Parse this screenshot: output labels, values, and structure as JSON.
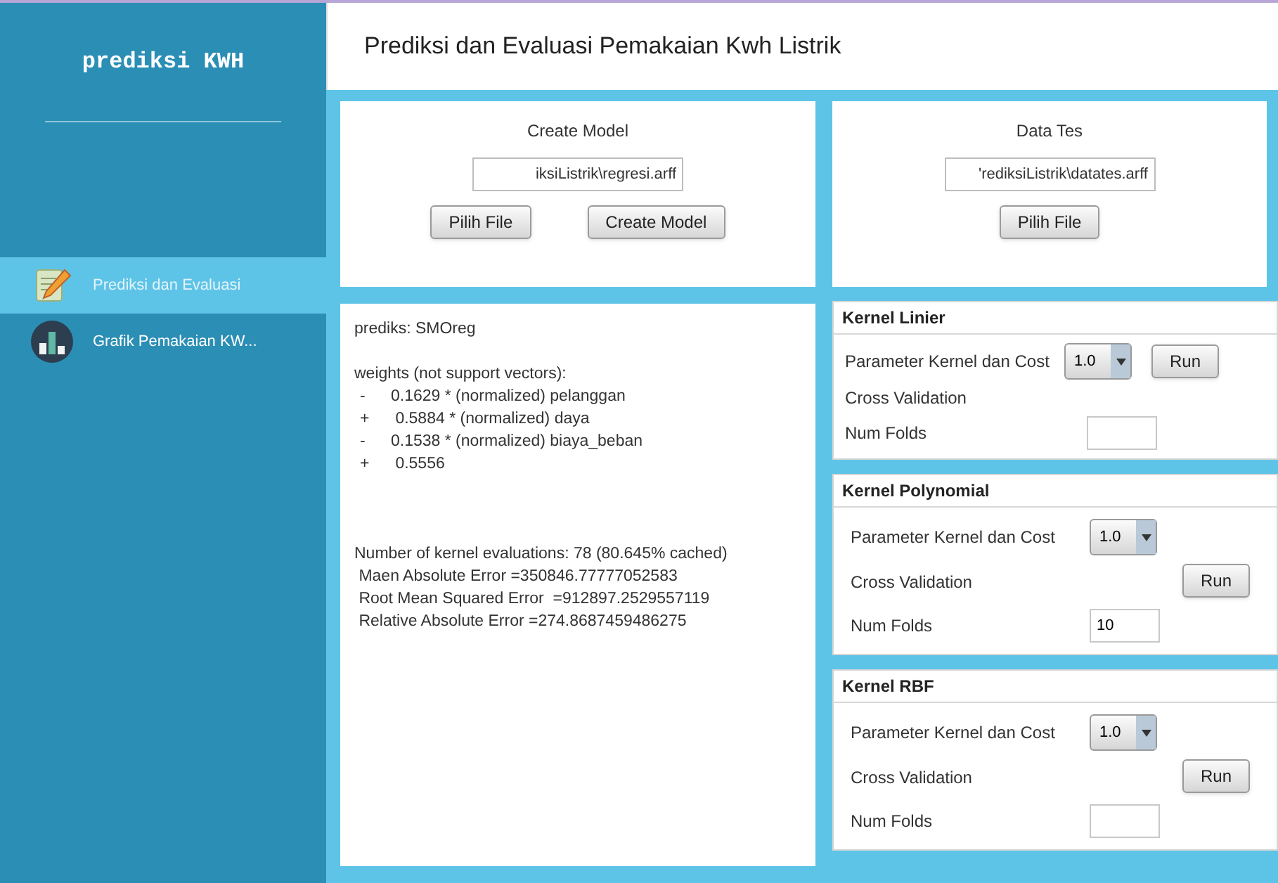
{
  "sidebar": {
    "title": "prediksi KWH",
    "items": [
      {
        "label": "Prediksi dan Evaluasi",
        "kind": "edit",
        "selected": true
      },
      {
        "label": "Grafik Pemakaian KW...",
        "kind": "chart",
        "selected": false
      }
    ]
  },
  "header": {
    "title": "Prediksi dan Evaluasi Pemakaian Kwh Listrik"
  },
  "create_model": {
    "title": "Create Model",
    "file_value": "iksiListrik\\regresi.arff",
    "buttons": [
      "Pilih File",
      "Create Model"
    ]
  },
  "data_tes": {
    "title": "Data Tes",
    "file_value": "'rediksiListrik\\datates.arff",
    "buttons": [
      "Pilih File"
    ]
  },
  "output": {
    "lines": [
      {
        "kind": "text",
        "text": "prediks: SMOreg"
      },
      {
        "kind": "gap"
      },
      {
        "kind": "text",
        "text": "weights (not support vectors):"
      },
      {
        "kind": "term",
        "sign": "-",
        "text": "0.1629 * (normalized) pelanggan"
      },
      {
        "kind": "term",
        "sign": "+",
        "text": " 0.5884 * (normalized) daya"
      },
      {
        "kind": "term",
        "sign": "-",
        "text": "0.1538 * (normalized) biaya_beban"
      },
      {
        "kind": "term",
        "sign": "+",
        "text": " 0.5556"
      },
      {
        "kind": "gap"
      },
      {
        "kind": "gap"
      },
      {
        "kind": "gap"
      },
      {
        "kind": "text",
        "text": "Number of kernel evaluations: 78 (80.645% cached)"
      },
      {
        "kind": "text",
        "text": " Maen Absolute Error =350846.77777052583"
      },
      {
        "kind": "text",
        "text": " Root Mean Squared Error  =912897.2529557119"
      },
      {
        "kind": "text",
        "text": " Relative Absolute Error =274.8687459486275"
      }
    ]
  },
  "kernels": [
    {
      "title": "Kernel Linier",
      "kind": "inline",
      "param_label": "Parameter Kernel dan Cost",
      "param_value": "1.0",
      "run": "Run",
      "cv_label": "Cross Validation",
      "folds_label": "Num Folds"
    },
    {
      "title": "Kernel Polynomial",
      "kind": "stacked",
      "param_label": "Parameter Kernel dan Cost",
      "param_value": "1.0",
      "run": "Run",
      "cv_label": "Cross Validation",
      "folds_label": "Num Folds",
      "folds_value": "10"
    },
    {
      "title": "Kernel RBF",
      "kind": "stacked",
      "param_label": "Parameter Kernel dan Cost",
      "param_value": "1.0",
      "run": "Run",
      "cv_label": "Cross Validation",
      "folds_label": "Num Folds"
    }
  ]
}
